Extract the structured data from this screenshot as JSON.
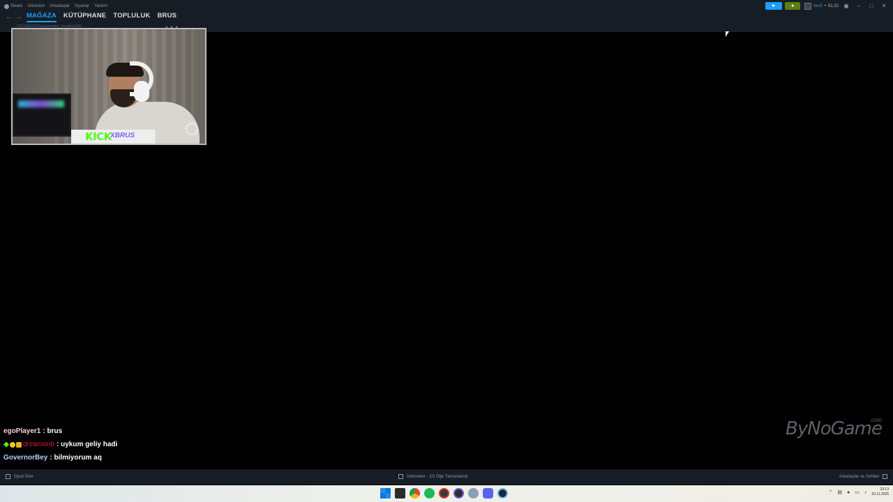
{
  "steam": {
    "menu": [
      "Steam",
      "Görünüm",
      "Arkadaşlar",
      "Oyunlar",
      "Yardım"
    ],
    "tabs": [
      "MAĞAZA",
      "KÜTÜPHANE",
      "TOPLULUK",
      "BRUS"
    ],
    "url": "...%2F2955%2FSupermarket_Together%2F",
    "user": {
      "name": "bruS",
      "balance": "51,22"
    },
    "bottom": {
      "add_game": "Oyun Ekle",
      "downloads": "İndirmeler - 2/2 Öğe Tamamlandı",
      "friends": "Arkadaşlar ve Sohbet"
    }
  },
  "webcam": {
    "kick_logo": "KICK",
    "streamer_tag": "XBRUS",
    "controls": "× × ×"
  },
  "chat": [
    {
      "user": "egoPlayer1",
      "message": ": brus",
      "color": "#ffd0e0"
    },
    {
      "user": "dreamonb",
      "message": ": uykum geliy hadi",
      "color": "#e01b3a",
      "badges": true
    },
    {
      "user": "GovernorBey",
      "message": ": bilmiyorum aq",
      "color": "#b9d2ff"
    }
  ],
  "watermark": {
    "text": "ByNoGame",
    "suffix": ".com"
  },
  "taskbar": {
    "icons": [
      "windows-start",
      "file-explorer",
      "chrome",
      "spotify",
      "app-red",
      "obs",
      "settings",
      "discord",
      "steam"
    ],
    "clock_time": "23:13",
    "clock_date": "20.11.2025"
  },
  "colors": {
    "accent": "#1a9fff",
    "steam_bg": "#171d25",
    "kick_green": "#53fc18"
  }
}
